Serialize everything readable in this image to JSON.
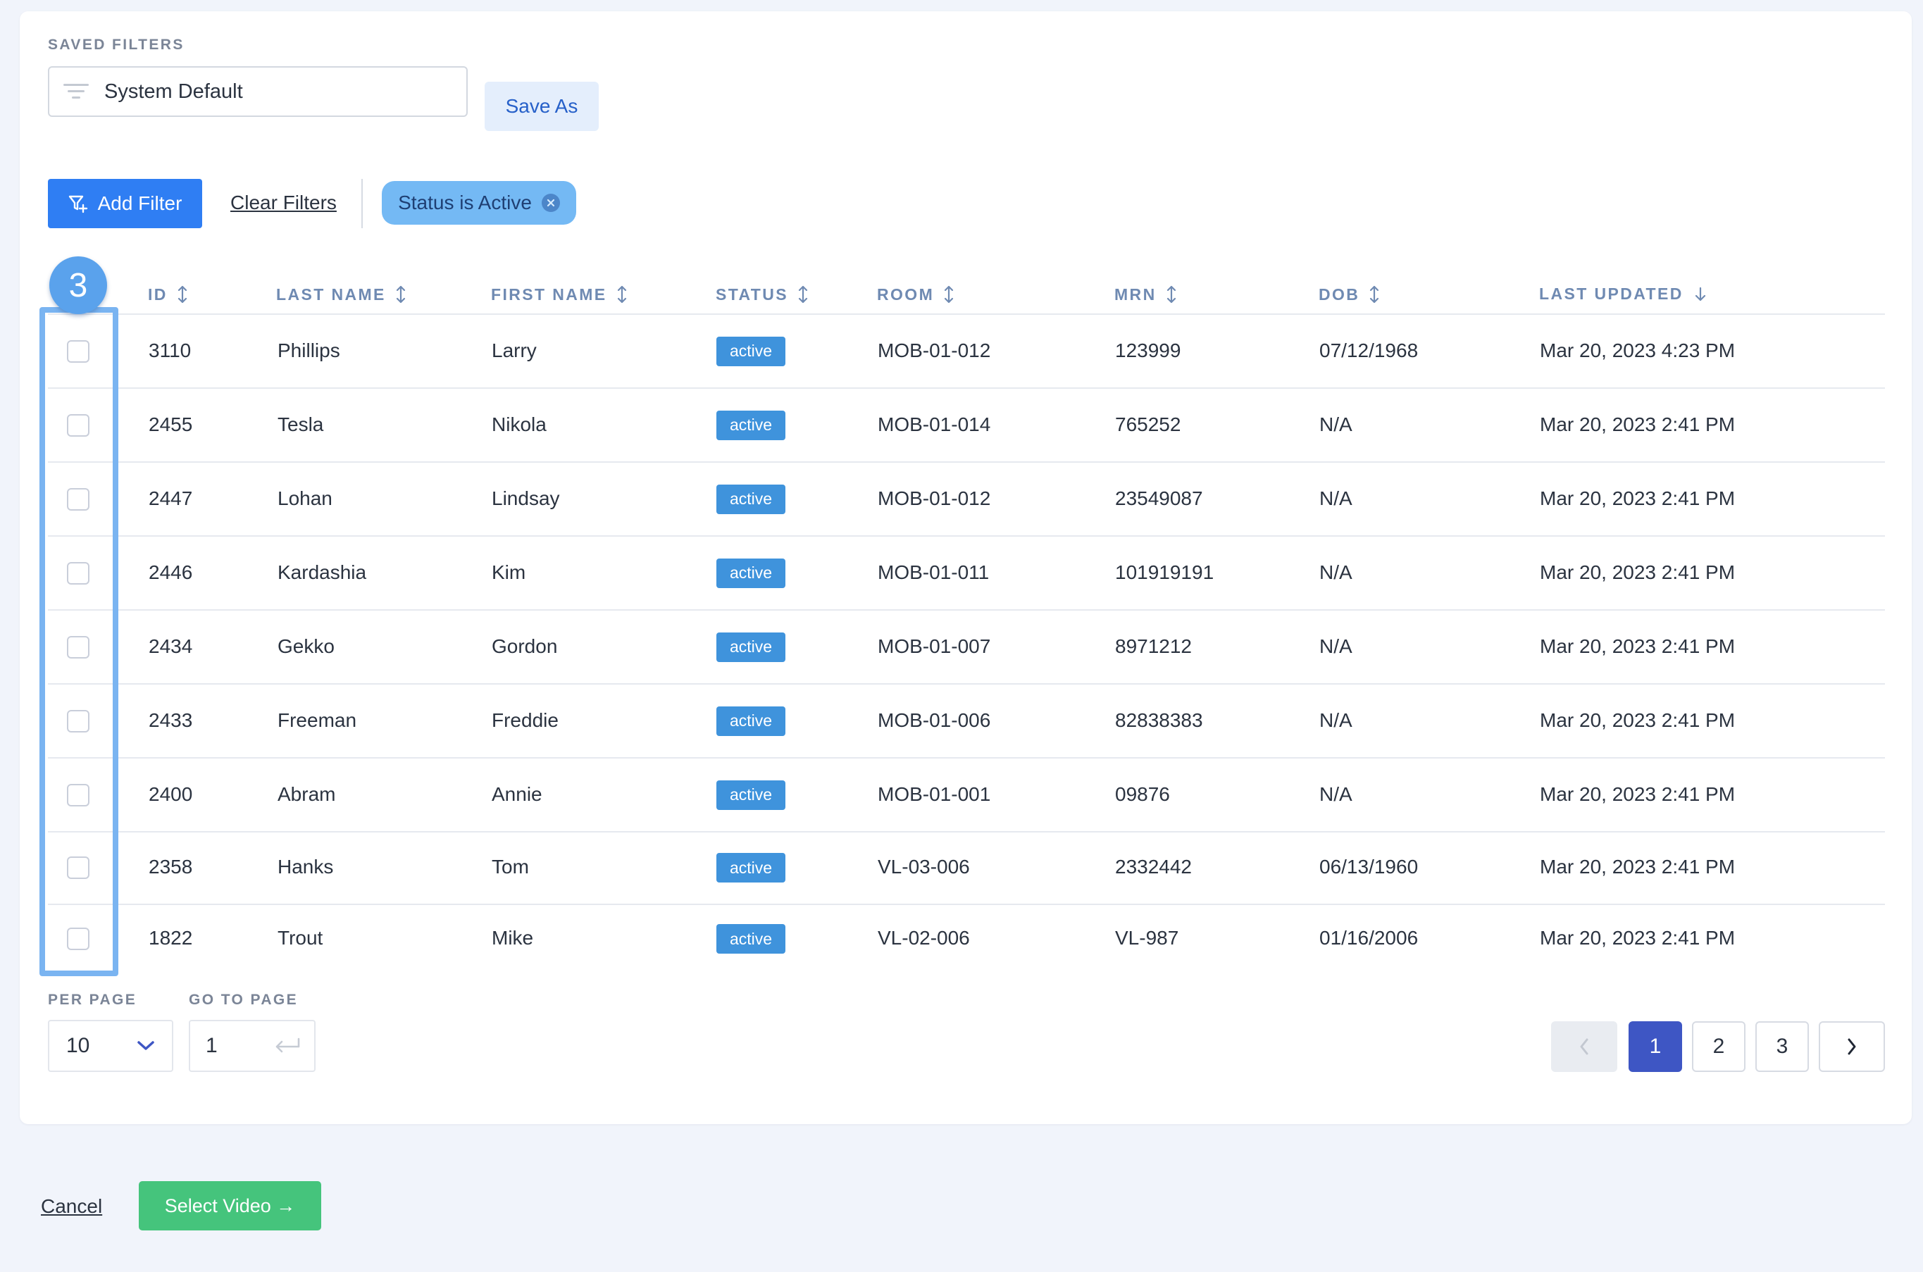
{
  "saved_filters": {
    "label": "SAVED FILTERS",
    "selected": "System Default",
    "save_as_label": "Save As",
    "icon": "filter-lines-icon"
  },
  "filters": {
    "add_filter_label": "Add Filter",
    "clear_filters_label": "Clear Filters",
    "active_chips": [
      "Status is Active"
    ],
    "colors": {
      "primary": "#2f7ef3",
      "chip": "#74b9f4"
    }
  },
  "annotation": {
    "step_number": "3",
    "color": "#7ab4f1"
  },
  "table": {
    "columns": [
      {
        "label": "ID",
        "sort_icon": "sort-both-icon"
      },
      {
        "label": "LAST NAME",
        "sort_icon": "sort-both-icon"
      },
      {
        "label": "FIRST NAME",
        "sort_icon": "sort-both-icon"
      },
      {
        "label": "STATUS",
        "sort_icon": "sort-both-icon"
      },
      {
        "label": "ROOM",
        "sort_icon": "sort-both-icon"
      },
      {
        "label": "MRN",
        "sort_icon": "sort-both-icon"
      },
      {
        "label": "DOB",
        "sort_icon": "sort-both-icon"
      },
      {
        "label": "LAST UPDATED",
        "sort_icon": "sort-desc-icon"
      }
    ],
    "rows": [
      {
        "id": "3110",
        "last": "Phillips",
        "first": "Larry",
        "status": "active",
        "room": "MOB-01-012",
        "mrn": "123999",
        "dob": "07/12/1968",
        "updated": "Mar 20, 2023 4:23 PM"
      },
      {
        "id": "2455",
        "last": "Tesla",
        "first": "Nikola",
        "status": "active",
        "room": "MOB-01-014",
        "mrn": "765252",
        "dob": "N/A",
        "updated": "Mar 20, 2023 2:41 PM"
      },
      {
        "id": "2447",
        "last": "Lohan",
        "first": "Lindsay",
        "status": "active",
        "room": "MOB-01-012",
        "mrn": "23549087",
        "dob": "N/A",
        "updated": "Mar 20, 2023 2:41 PM"
      },
      {
        "id": "2446",
        "last": "Kardashia",
        "first": "Kim",
        "status": "active",
        "room": "MOB-01-011",
        "mrn": "101919191",
        "dob": "N/A",
        "updated": "Mar 20, 2023 2:41 PM"
      },
      {
        "id": "2434",
        "last": "Gekko",
        "first": "Gordon",
        "status": "active",
        "room": "MOB-01-007",
        "mrn": "8971212",
        "dob": "N/A",
        "updated": "Mar 20, 2023 2:41 PM"
      },
      {
        "id": "2433",
        "last": "Freeman",
        "first": "Freddie",
        "status": "active",
        "room": "MOB-01-006",
        "mrn": "82838383",
        "dob": "N/A",
        "updated": "Mar 20, 2023 2:41 PM"
      },
      {
        "id": "2400",
        "last": "Abram",
        "first": "Annie",
        "status": "active",
        "room": "MOB-01-001",
        "mrn": "09876",
        "dob": "N/A",
        "updated": "Mar 20, 2023 2:41 PM"
      },
      {
        "id": "2358",
        "last": "Hanks",
        "first": "Tom",
        "status": "active",
        "room": "VL-03-006",
        "mrn": "2332442",
        "dob": "06/13/1960",
        "updated": "Mar 20, 2023 2:41 PM"
      },
      {
        "id": "1822",
        "last": "Trout",
        "first": "Mike",
        "status": "active",
        "room": "VL-02-006",
        "mrn": "VL-987",
        "dob": "01/16/2006",
        "updated": "Mar 20, 2023 2:41 PM"
      }
    ],
    "status_color": "#3f93dc"
  },
  "pagination": {
    "per_page_label": "PER PAGE",
    "per_page_value": "10",
    "go_to_page_label": "GO TO PAGE",
    "go_to_page_value": "1",
    "pages": [
      "1",
      "2",
      "3"
    ],
    "current_page": "1",
    "prev_icon": "chevron-left-icon",
    "next_icon": "chevron-right-icon"
  },
  "footer": {
    "cancel_label": "Cancel",
    "select_video_label": "Select Video →",
    "select_video_color": "#45c47c"
  }
}
